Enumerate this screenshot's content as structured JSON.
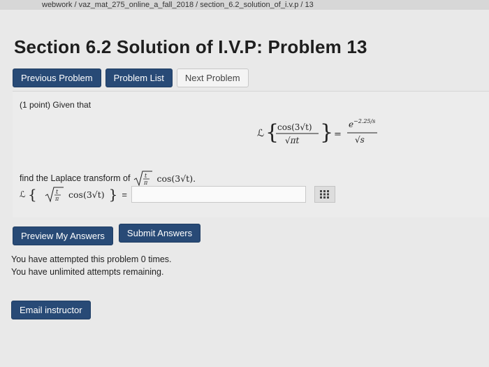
{
  "breadcrumb": "webwork / vaz_mat_275_online_a_fall_2018 / section_6.2_solution_of_i.v.p / 13",
  "page_title": "Section 6.2 Solution of I.V.P: Problem 13",
  "nav": {
    "previous": "Previous Problem",
    "list": "Problem List",
    "next": "Next Problem"
  },
  "problem": {
    "points": "(1 point) Given that",
    "given": {
      "operator": "ℒ",
      "numerator": "cos(3√t)",
      "denominator": "√πt",
      "rhs_numerator": "e",
      "rhs_exponent": "−2.25/s",
      "rhs_denominator": "√s"
    },
    "find_text": "find the Laplace transform of",
    "find_expr": "cos(3√t).",
    "answer_expr": "cos(3√t)",
    "equals": "=",
    "answer_value": ""
  },
  "actions": {
    "preview": "Preview My Answers",
    "submit": "Submit Answers"
  },
  "status": {
    "attempted": "You have attempted this problem 0 times.",
    "remaining": "You have unlimited attempts remaining."
  },
  "email": "Email instructor",
  "colors": {
    "primary_button": "#284a76",
    "background": "#e9e9e9"
  }
}
